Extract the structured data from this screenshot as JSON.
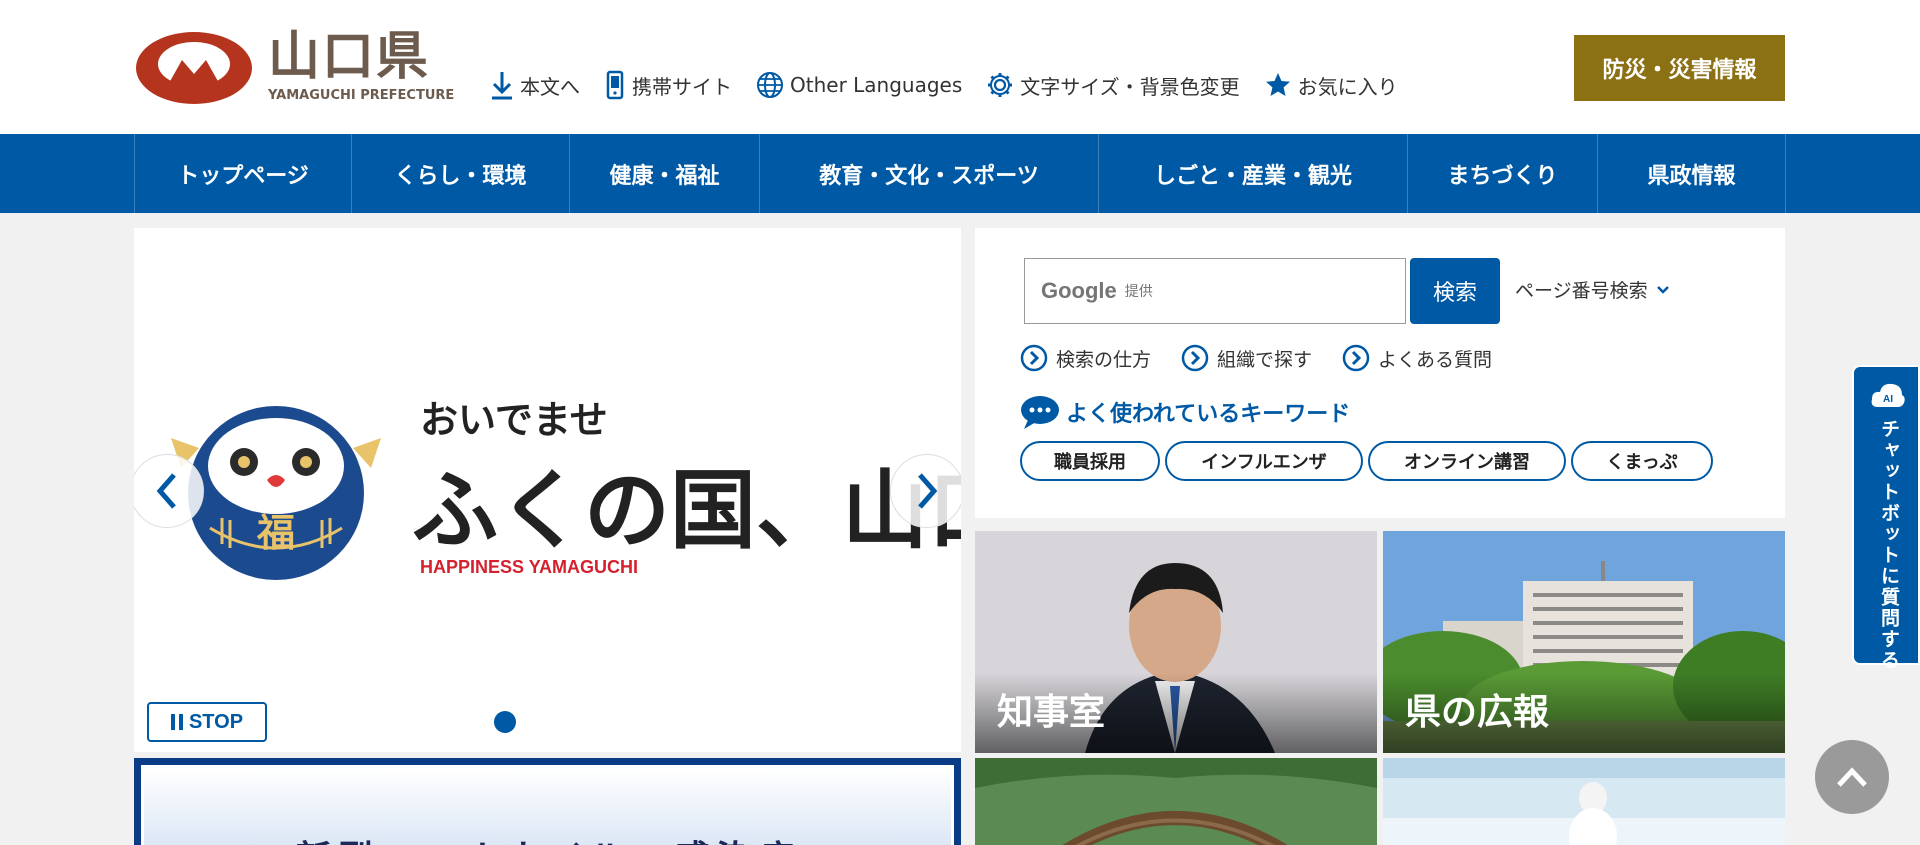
{
  "header": {
    "logo_ja": "山口県",
    "logo_en": "YAMAGUCHI PREFECTURE",
    "util_nav": [
      {
        "label": "本文へ",
        "icon": "arrow-down-icon"
      },
      {
        "label": "携帯サイト",
        "icon": "mobile-phone-icon"
      },
      {
        "label": "Other Languages",
        "icon": "globe-icon"
      },
      {
        "label": "文字サイズ・背景色変更",
        "icon": "gear-icon"
      },
      {
        "label": "お気に入り",
        "icon": "star-icon"
      }
    ],
    "disaster_button": "防災・災害情報"
  },
  "global_nav": [
    "トップページ",
    "くらし・環境",
    "健康・福祉",
    "教育・文化・スポーツ",
    "しごと・産業・観光",
    "まちづくり",
    "県政情報"
  ],
  "slider": {
    "slide_greeting": "おいでませ",
    "slide_title": "ふくの国、山口",
    "slide_subtitle": "HAPPINESS YAMAGUCHI",
    "daruma_char": "福",
    "stop_label": "STOP"
  },
  "banner2": {
    "text": "新型コロナウイルス感染症"
  },
  "search": {
    "provider": "Google",
    "provider_sub": "提供",
    "button_label": "検索",
    "page_number_search": "ページ番号検索",
    "links": [
      "検索の仕方",
      "組織で探す",
      "よくある質問"
    ],
    "keyword_heading": "よく使われているキーワード",
    "keywords": [
      "職員採用",
      "インフルエンザ",
      "オンライン講習",
      "くまっぷ"
    ]
  },
  "tiles": {
    "governor": "知事室",
    "pr": "県の広報"
  },
  "chatbot": {
    "badge": "AI",
    "label": "チャットボットに質問する"
  },
  "colors": {
    "primary": "#0059a4",
    "disaster": "#8b7014",
    "logo_red": "#b5341e",
    "logo_brown": "#6d5b4e"
  }
}
